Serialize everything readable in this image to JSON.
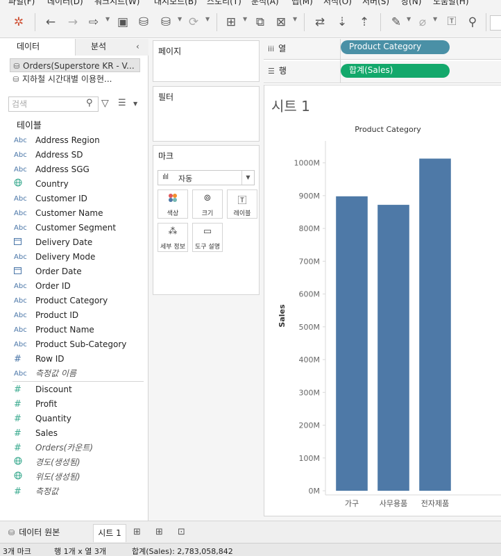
{
  "menu": [
    "파일(F)",
    "데이터(D)",
    "워크시트(W)",
    "대시보드(B)",
    "스토리(T)",
    "분석(A)",
    "맵(M)",
    "서식(O)",
    "서버(S)",
    "창(N)",
    "도움말(H)"
  ],
  "toolbar": {
    "icons": [
      "tableau-logo-icon",
      "undo-icon",
      "redo-icon",
      "replay-icon",
      "save-icon",
      "new-datasource-icon",
      "pause-updates-icon",
      "refresh-icon",
      "new-worksheet-icon",
      "duplicate-icon",
      "clear-sheet-icon",
      "swap-icon",
      "sort-ascending-icon",
      "sort-descending-icon",
      "highlight-icon",
      "group-icon",
      "show-labels-icon",
      "pin-icon"
    ]
  },
  "left_pane": {
    "tabs": {
      "data": "데이터",
      "analysis": "분석"
    },
    "datasources": [
      "Orders(Superstore KR - V...",
      "지하철 시간대별 이용현..."
    ],
    "search_placeholder": "검색",
    "tables_heading": "테이블",
    "dimensions": [
      {
        "type": "Abc",
        "name": "Address Region",
        "italic": false
      },
      {
        "type": "Abc",
        "name": "Address SD",
        "italic": false
      },
      {
        "type": "Abc",
        "name": "Address SGG",
        "italic": false
      },
      {
        "type": "geo",
        "name": "Country",
        "italic": false
      },
      {
        "type": "Abc",
        "name": "Customer ID",
        "italic": false
      },
      {
        "type": "Abc",
        "name": "Customer Name",
        "italic": false
      },
      {
        "type": "Abc",
        "name": "Customer Segment",
        "italic": false
      },
      {
        "type": "date",
        "name": "Delivery Date",
        "italic": false
      },
      {
        "type": "Abc",
        "name": "Delivery Mode",
        "italic": false
      },
      {
        "type": "date",
        "name": "Order Date",
        "italic": false
      },
      {
        "type": "Abc",
        "name": "Order ID",
        "italic": false
      },
      {
        "type": "Abc",
        "name": "Product Category",
        "italic": false
      },
      {
        "type": "Abc",
        "name": "Product ID",
        "italic": false
      },
      {
        "type": "Abc",
        "name": "Product Name",
        "italic": false
      },
      {
        "type": "Abc",
        "name": "Product Sub-Category",
        "italic": false
      },
      {
        "type": "num",
        "name": "Row ID",
        "italic": false
      },
      {
        "type": "Abc",
        "name": "측정값 이름",
        "italic": true
      }
    ],
    "measures": [
      {
        "type": "num",
        "name": "Discount",
        "italic": false
      },
      {
        "type": "num",
        "name": "Profit",
        "italic": false
      },
      {
        "type": "num",
        "name": "Quantity",
        "italic": false
      },
      {
        "type": "num",
        "name": "Sales",
        "italic": false
      },
      {
        "type": "num",
        "name": "Orders(카운트)",
        "italic": true
      },
      {
        "type": "geo",
        "name": "경도(생성됨)",
        "italic": true
      },
      {
        "type": "geo",
        "name": "위도(생성됨)",
        "italic": true
      },
      {
        "type": "num",
        "name": "측정값",
        "italic": true
      }
    ]
  },
  "shelves": {
    "pages": "페이지",
    "filters": "필터",
    "marks": "마크",
    "mark_type": "자동",
    "mark_buttons": [
      "색상",
      "크기",
      "레이블",
      "세부 정보",
      "도구 설명"
    ],
    "columns_label": "열",
    "rows_label": "행",
    "columns_pill": "Product Category",
    "rows_pill": "합계(Sales)"
  },
  "view": {
    "sheet_title": "시트 1"
  },
  "chart_data": {
    "type": "bar",
    "title": "Product Category",
    "xlabel": "",
    "ylabel": "Sales",
    "categories": [
      "가구",
      "사무용품",
      "전자제품"
    ],
    "values": [
      898000000,
      872000000,
      1013000000
    ],
    "ylim": [
      0,
      1050000000
    ],
    "yticks": [
      0,
      100000000,
      200000000,
      300000000,
      400000000,
      500000000,
      600000000,
      700000000,
      800000000,
      900000000,
      1000000000
    ],
    "ytick_labels": [
      "0M",
      "100M",
      "200M",
      "300M",
      "400M",
      "500M",
      "600M",
      "700M",
      "800M",
      "900M",
      "1000M"
    ],
    "bar_color": "#4e79a7",
    "grid": false
  },
  "bottom_tabs": {
    "datasource": "데이터 원본",
    "sheet": "시트 1"
  },
  "status": {
    "marks": "3개 마크",
    "rows_cols": "행 1개 x 열 3개",
    "sum": "합계(Sales): 2,783,058,842"
  }
}
